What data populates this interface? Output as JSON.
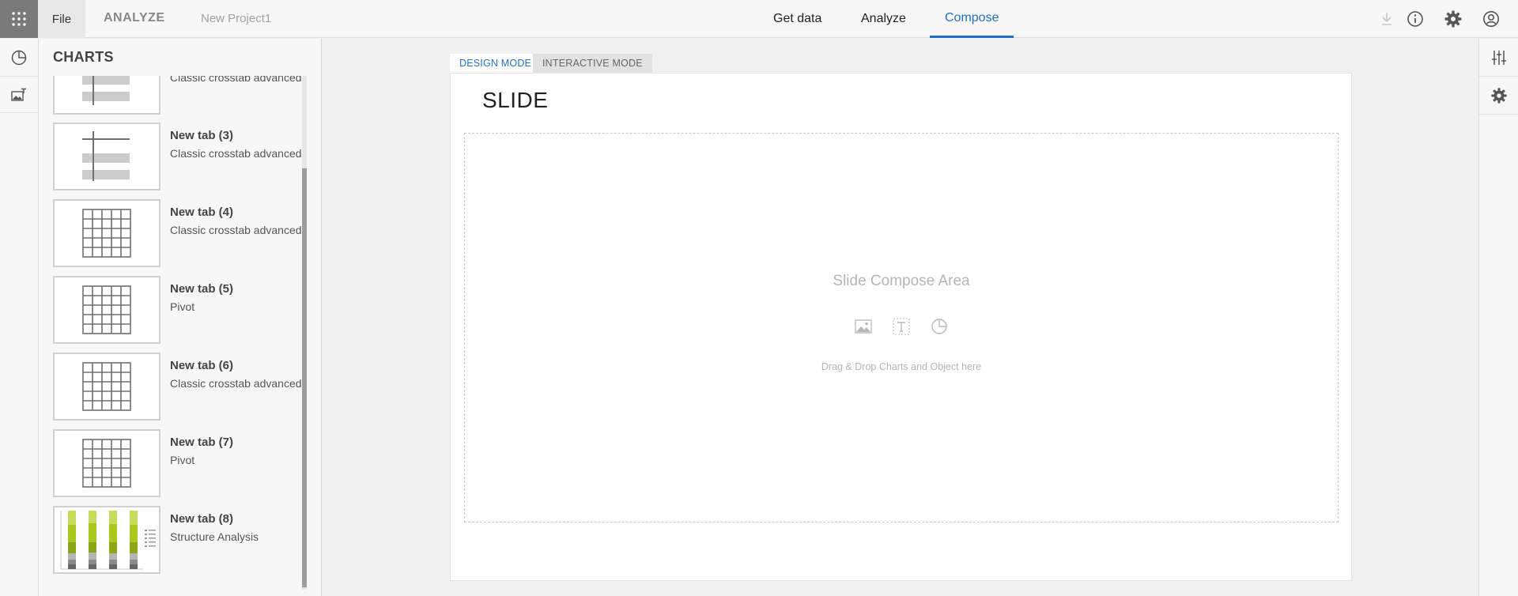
{
  "topbar": {
    "apps_icon": "apps-grid-icon",
    "file_label": "File",
    "module_label": "ANALYZE",
    "project_name": "New Project1",
    "nav": [
      {
        "label": "Get data",
        "active": false
      },
      {
        "label": "Analyze",
        "active": false
      },
      {
        "label": "Compose",
        "active": true
      }
    ],
    "icons": [
      "download-icon",
      "info-icon",
      "gear-icon",
      "user-icon"
    ]
  },
  "left_rail": {
    "items": [
      "chart-pie-icon",
      "image-text-icon"
    ]
  },
  "charts_panel": {
    "title": "CHARTS",
    "items": [
      {
        "name": "",
        "subtitle": "Classic crosstab advanced",
        "thumb": "crosstab"
      },
      {
        "name": "New tab (3)",
        "subtitle": "Classic crosstab advanced",
        "thumb": "crosstab"
      },
      {
        "name": "New tab (4)",
        "subtitle": "Classic crosstab advanced",
        "thumb": "grid"
      },
      {
        "name": "New tab (5)",
        "subtitle": "Pivot",
        "thumb": "grid"
      },
      {
        "name": "New tab (6)",
        "subtitle": "Classic crosstab advanced",
        "thumb": "grid"
      },
      {
        "name": "New tab (7)",
        "subtitle": "Pivot",
        "thumb": "grid"
      },
      {
        "name": "New tab (8)",
        "subtitle": "Structure Analysis",
        "thumb": "bars"
      }
    ]
  },
  "main": {
    "mode_tabs": [
      {
        "label": "DESIGN MODE",
        "active": true
      },
      {
        "label": "INTERACTIVE MODE",
        "active": false
      }
    ],
    "slide_title": "SLIDE",
    "compose_label": "Slide Compose Area",
    "compose_hint": "Drag & Drop Charts and Object here",
    "compose_icons": [
      "image-icon",
      "text-box-icon",
      "chart-pie-icon"
    ]
  },
  "right_rail": {
    "items": [
      "sliders-icon",
      "gear-icon"
    ]
  },
  "colors": {
    "accent": "#1f6fc5",
    "apps_bg": "#7a7a7a",
    "thumb_bar": "#cccccc",
    "thumb_line": "#707070",
    "bar_green": "#a8c81c"
  }
}
